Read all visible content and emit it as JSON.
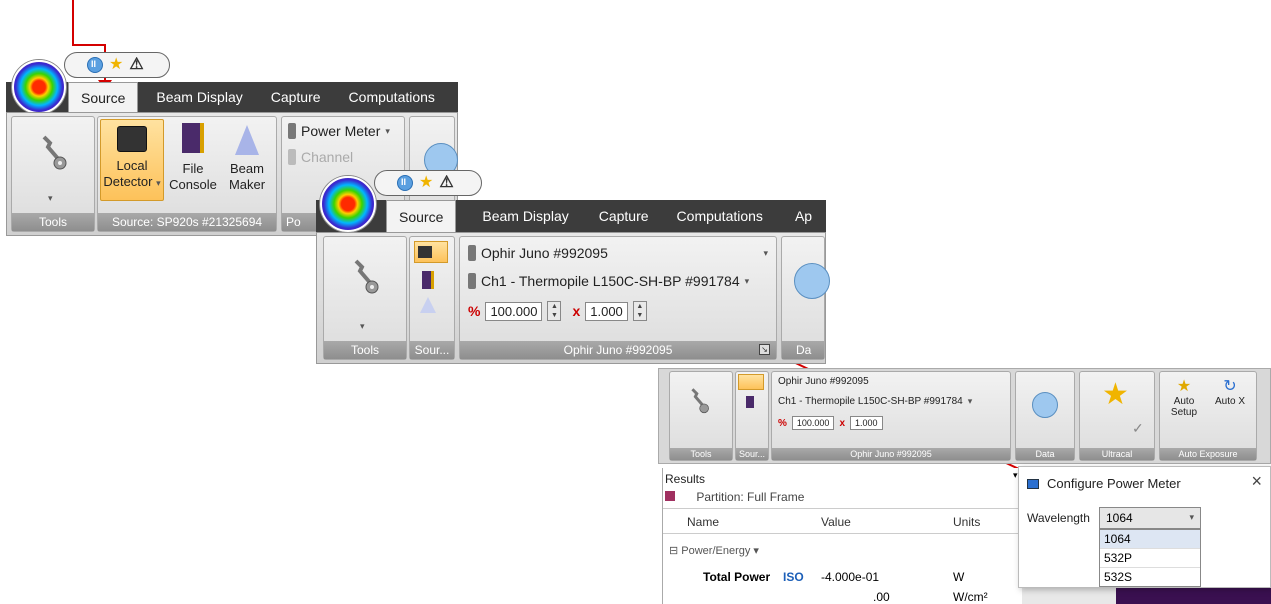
{
  "colors": {
    "annotation": "#d40000",
    "tabbar": "#3c3c3c",
    "group_label": "#9a9a9a"
  },
  "ribbon1": {
    "tabs": [
      "Source",
      "Beam Display",
      "Capture",
      "Computations"
    ],
    "tools_label": "Tools",
    "local_detector": {
      "line1": "Local",
      "line2": "Detector"
    },
    "file_console": {
      "line1": "File",
      "line2": "Console"
    },
    "beam_maker": {
      "line1": "Beam",
      "line2": "Maker"
    },
    "source_group_label": "Source: SP920s #21325694",
    "power_meter_label": "Power Meter",
    "channel_label": "Channel",
    "po_group_label": "Po"
  },
  "ribbon2": {
    "tabs": [
      "Source",
      "Beam Display",
      "Capture",
      "Computations",
      "Ap"
    ],
    "tools_label": "Tools",
    "source_label": "Sour...",
    "device": "Ophir Juno #992095",
    "channel": "Ch1 - Thermopile L150C-SH-BP #991784",
    "scale_value": "100.000",
    "multiplier_value": "1.000",
    "group_label": "Ophir Juno #992095",
    "next_group_label": "Da"
  },
  "ribbon3": {
    "tools_label": "Tools",
    "source_label": "Sour...",
    "device": "Ophir Juno #992095",
    "channel": "Ch1 - Thermopile L150C-SH-BP #991784",
    "scale_value": "100.000",
    "multiplier_value": "1.000",
    "group_label": "Ophir Juno #992095",
    "data_label": "Data",
    "ultracal_label": "Ultracal",
    "auto_setup": {
      "line1": "Auto",
      "line2": "Setup"
    },
    "auto_x": "Auto X",
    "auto_exposure_label": "Auto Exposure"
  },
  "results": {
    "title": "Results",
    "partition": "Partition: Full Frame",
    "columns": [
      "Name",
      "Value",
      "Units"
    ],
    "section": "Power/Energy",
    "rows": [
      {
        "name": "Total Power",
        "iso": "ISO",
        "value": "-4.000e-01",
        "unit": "W"
      },
      {
        "name": "",
        "iso": "",
        "value": ".00",
        "unit": "W/cm²"
      }
    ]
  },
  "dialog": {
    "title": "Configure Power Meter",
    "close": "×",
    "wavelength_label": "Wavelength",
    "selected": "1064",
    "options": [
      "1064",
      "532P",
      "532S"
    ]
  }
}
